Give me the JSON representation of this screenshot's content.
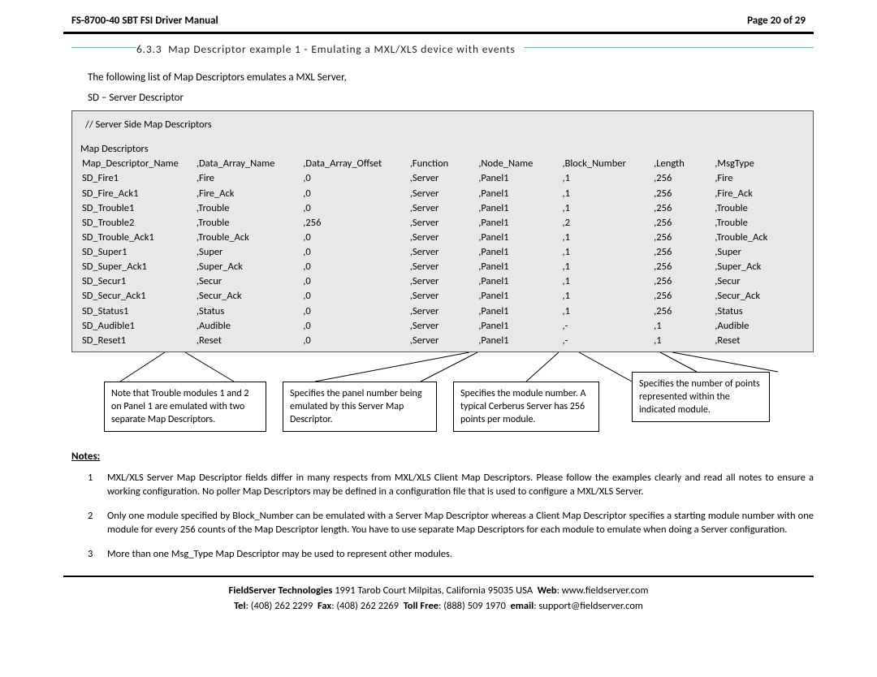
{
  "header": {
    "title": "FS-8700-40 SBT FSI Driver Manual",
    "page": "Page 20 of 29"
  },
  "section": {
    "number": "6.3.3",
    "title": "Map Descriptor example 1 - Emulating a MXL/XLS device with events"
  },
  "intro": "The following list of Map Descriptors emulates a MXL Server,",
  "sd_line": "SD – Server Descriptor",
  "code_comment": "//    Server Side Map Descriptors",
  "code_heading": "Map Descriptors",
  "columns": [
    "Map_Descriptor_Name",
    "Data_Array_Name",
    "Data_Array_Offset",
    "Function",
    "Node_Name",
    "Block_Number",
    "Length",
    "MsgType"
  ],
  "col_hdr_raw": [
    "Map_Descriptor_Name",
    ",Data_Array_Name",
    ",Data_Array_Offset",
    ",Function",
    ",Node_Name",
    ",Block_Number",
    ",Length",
    ",MsgType"
  ],
  "rows": [
    [
      "SD_Fire1",
      ",Fire",
      ",0",
      ",Server",
      ",Panel1",
      ",1",
      ",256",
      ",Fire"
    ],
    [
      "SD_Fire_Ack1",
      ",Fire_Ack",
      ",0",
      ",Server",
      ",Panel1",
      ",1",
      ",256",
      ",Fire_Ack"
    ],
    [
      "SD_Trouble1",
      ",Trouble",
      ",0",
      ",Server",
      ",Panel1",
      ",1",
      ",256",
      ",Trouble"
    ],
    [
      "SD_Trouble2",
      ",Trouble",
      ",256",
      ",Server",
      ",Panel1",
      ",2",
      ",256",
      ",Trouble"
    ],
    [
      "SD_Trouble_Ack1",
      ",Trouble_Ack",
      ",0",
      ",Server",
      ",Panel1",
      ",1",
      ",256",
      ",Trouble_Ack"
    ],
    [
      "SD_Super1",
      ",Super",
      ",0",
      ",Server",
      ",Panel1",
      ",1",
      ",256",
      ",Super"
    ],
    [
      "SD_Super_Ack1",
      ",Super_Ack",
      ",0",
      ",Server",
      ",Panel1",
      ",1",
      ",256",
      ",Super_Ack"
    ],
    [
      "SD_Secur1",
      ",Secur",
      ",0",
      ",Server",
      ",Panel1",
      ",1",
      ",256",
      ",Secur"
    ],
    [
      "SD_Secur_Ack1",
      ",Secur_Ack",
      ",0",
      ",Server",
      ",Panel1",
      ",1",
      ",256",
      ",Secur_Ack"
    ],
    [
      "SD_Status1",
      ",Status",
      ",0",
      ",Server",
      ",Panel1",
      ",1",
      ",256",
      ",Status"
    ],
    [
      "SD_Audible1",
      ",Audible",
      ",0",
      ",Server",
      ",Panel1",
      ",-",
      ",1",
      ",Audible"
    ],
    [
      "SD_Reset1",
      ",Reset",
      ",0",
      ",Server",
      ",Panel1",
      ",-",
      ",1",
      ",Reset"
    ]
  ],
  "callouts": {
    "c1": "Note that Trouble modules 1 and 2 on Panel 1 are emulated with two separate Map Descriptors.",
    "c2": "Specifies the panel number being emulated by this Server Map Descriptor.",
    "c3": "Specifies the module number.  A typical Cerberus Server has 256 points per module.",
    "c4": "Specifies the number of points represented within the indicated module."
  },
  "notes_heading": "Notes:",
  "notes": [
    "MXL/XLS Server Map Descriptor fields differ in many respects from MXL/XLS Client Map Descriptors.  Please follow the examples clearly and read all notes to ensure a working configuration.  No poller Map Descriptors may be defined in a configuration file that is used to configure a MXL/XLS Server.",
    "Only one module specified by Block_Number can be emulated with a Server Map Descriptor whereas a Client Map Descriptor specifies a starting module number with one module for every 256 counts of the Map Descriptor length.  You have to use separate Map Descriptors for each module to emulate when doing a Server configuration.",
    "More than one Msg_Type Map Descriptor may be used to represent other modules."
  ],
  "footer": {
    "company": "FieldServer Technologies",
    "address": "1991 Tarob Court Milpitas, California 95035 USA",
    "web_label": "Web",
    "web": "www.fieldserver.com",
    "tel_label": "Tel",
    "tel": "(408) 262 2299",
    "fax_label": "Fax",
    "fax": "(408) 262 2269",
    "tollfree_label": "Toll Free",
    "tollfree": "(888) 509 1970",
    "email_label": "email",
    "email": "support@fieldserver.com"
  }
}
